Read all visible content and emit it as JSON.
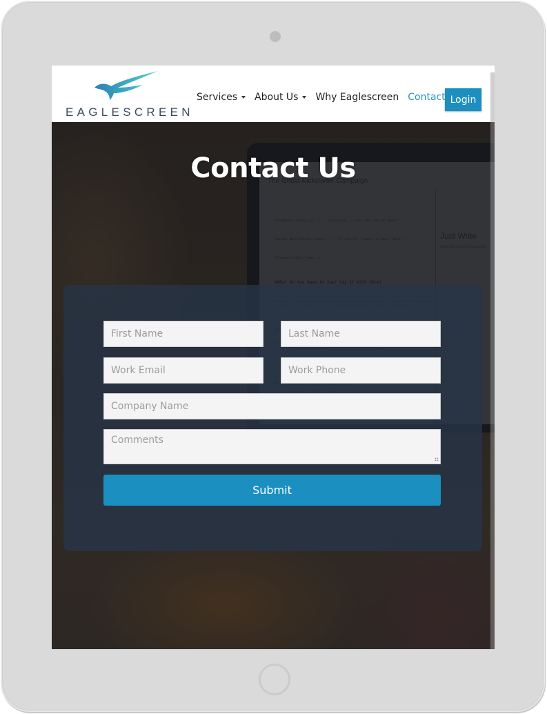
{
  "device": {
    "camera_icon": "camera-dot",
    "home_button_icon": "home-circle"
  },
  "header": {
    "logo_text": "EAGLESCREEN",
    "logo_icon": "eagle-swoosh-icon",
    "nav": [
      {
        "label": "Services",
        "has_dropdown": true,
        "active": false
      },
      {
        "label": "About Us",
        "has_dropdown": true,
        "active": false
      },
      {
        "label": "Why Eaglescreen",
        "has_dropdown": false,
        "active": false
      },
      {
        "label": "Contact Us",
        "has_dropdown": false,
        "active": true
      }
    ],
    "login_label": "Login"
  },
  "hero": {
    "title": "Contact Us",
    "background_screen": {
      "title": "The Ghost Kickstarter Campaign",
      "heading": "#What Do You Have to Say? Say it With Ghost",
      "subheading": "## Just Write",
      "sub2": "## A Dashboard that Makes Sense",
      "side_heading": "Just Write",
      "side_text": "Ghost has a smart writing screen..."
    }
  },
  "form": {
    "first_name_placeholder": "First Name",
    "last_name_placeholder": "Last Name",
    "work_email_placeholder": "Work Email",
    "work_phone_placeholder": "Work Phone",
    "company_placeholder": "Company Name",
    "comments_placeholder": "Comments",
    "submit_label": "Submit"
  },
  "colors": {
    "accent": "#1b8fc0",
    "active_nav": "#2a93c3",
    "panel": "#263448",
    "device_frame": "#dadada"
  }
}
